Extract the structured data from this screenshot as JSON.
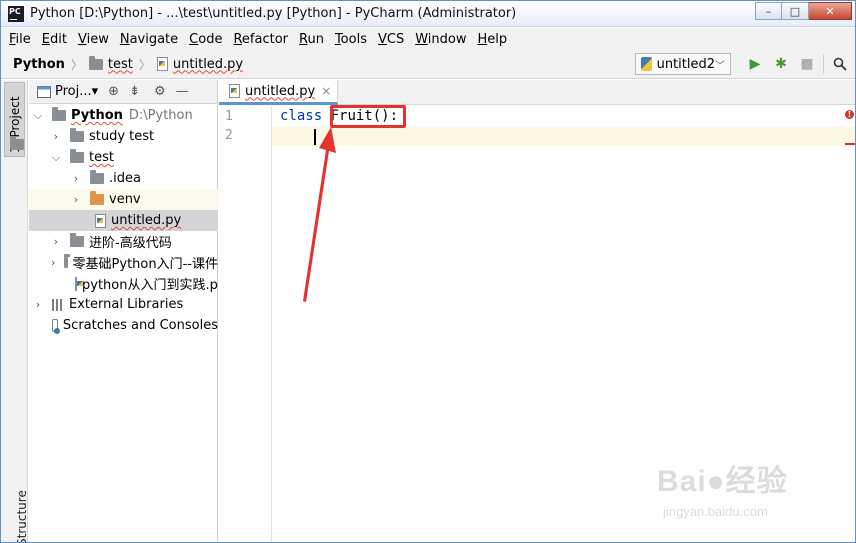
{
  "window": {
    "title": "Python [D:\\Python] - ...\\test\\untitled.py [Python] - PyCharm (Administrator)",
    "app_icon_text": "PC",
    "controls": [
      "–",
      "□",
      "✕"
    ]
  },
  "menu": [
    "File",
    "Edit",
    "View",
    "Navigate",
    "Code",
    "Refactor",
    "Run",
    "Tools",
    "VCS",
    "Window",
    "Help"
  ],
  "breadcrumb": [
    "Python",
    "test",
    "untitled.py"
  ],
  "run_config": "untitled2",
  "toolbar": {
    "run": "▶",
    "debug": "✱",
    "stop": "■",
    "search": "⌕"
  },
  "left_strip": {
    "project_tab": "1: Project",
    "structure_tab": "Structure"
  },
  "project_panel": {
    "title": "Proj...▾",
    "tree": [
      {
        "label": "Python",
        "extra": "D:\\Python",
        "twisty": "⌵"
      },
      {
        "label": "study test",
        "twisty": "›"
      },
      {
        "label": "test",
        "twisty": "⌵"
      },
      {
        "label": ".idea",
        "twisty": "›"
      },
      {
        "label": "venv",
        "twisty": "›"
      },
      {
        "label": "untitled.py"
      },
      {
        "label": "进阶-高级代码",
        "twisty": "›"
      },
      {
        "label": "零基础Python入门--课件",
        "twisty": "›"
      },
      {
        "label": "python从入门到实践.pdf"
      },
      {
        "label": "External Libraries",
        "twisty": "›"
      },
      {
        "label": "Scratches and Consoles"
      }
    ]
  },
  "editor": {
    "tab_label": "untitled.py",
    "tab_close": "×",
    "line_numbers": [
      "1",
      "2"
    ],
    "code": {
      "keyword": "class",
      "name": "Fruit",
      "tail": "():"
    },
    "error_mark": "!"
  },
  "watermark": {
    "main": "Bai●经验",
    "sub": "jingyan.baidu.com"
  }
}
